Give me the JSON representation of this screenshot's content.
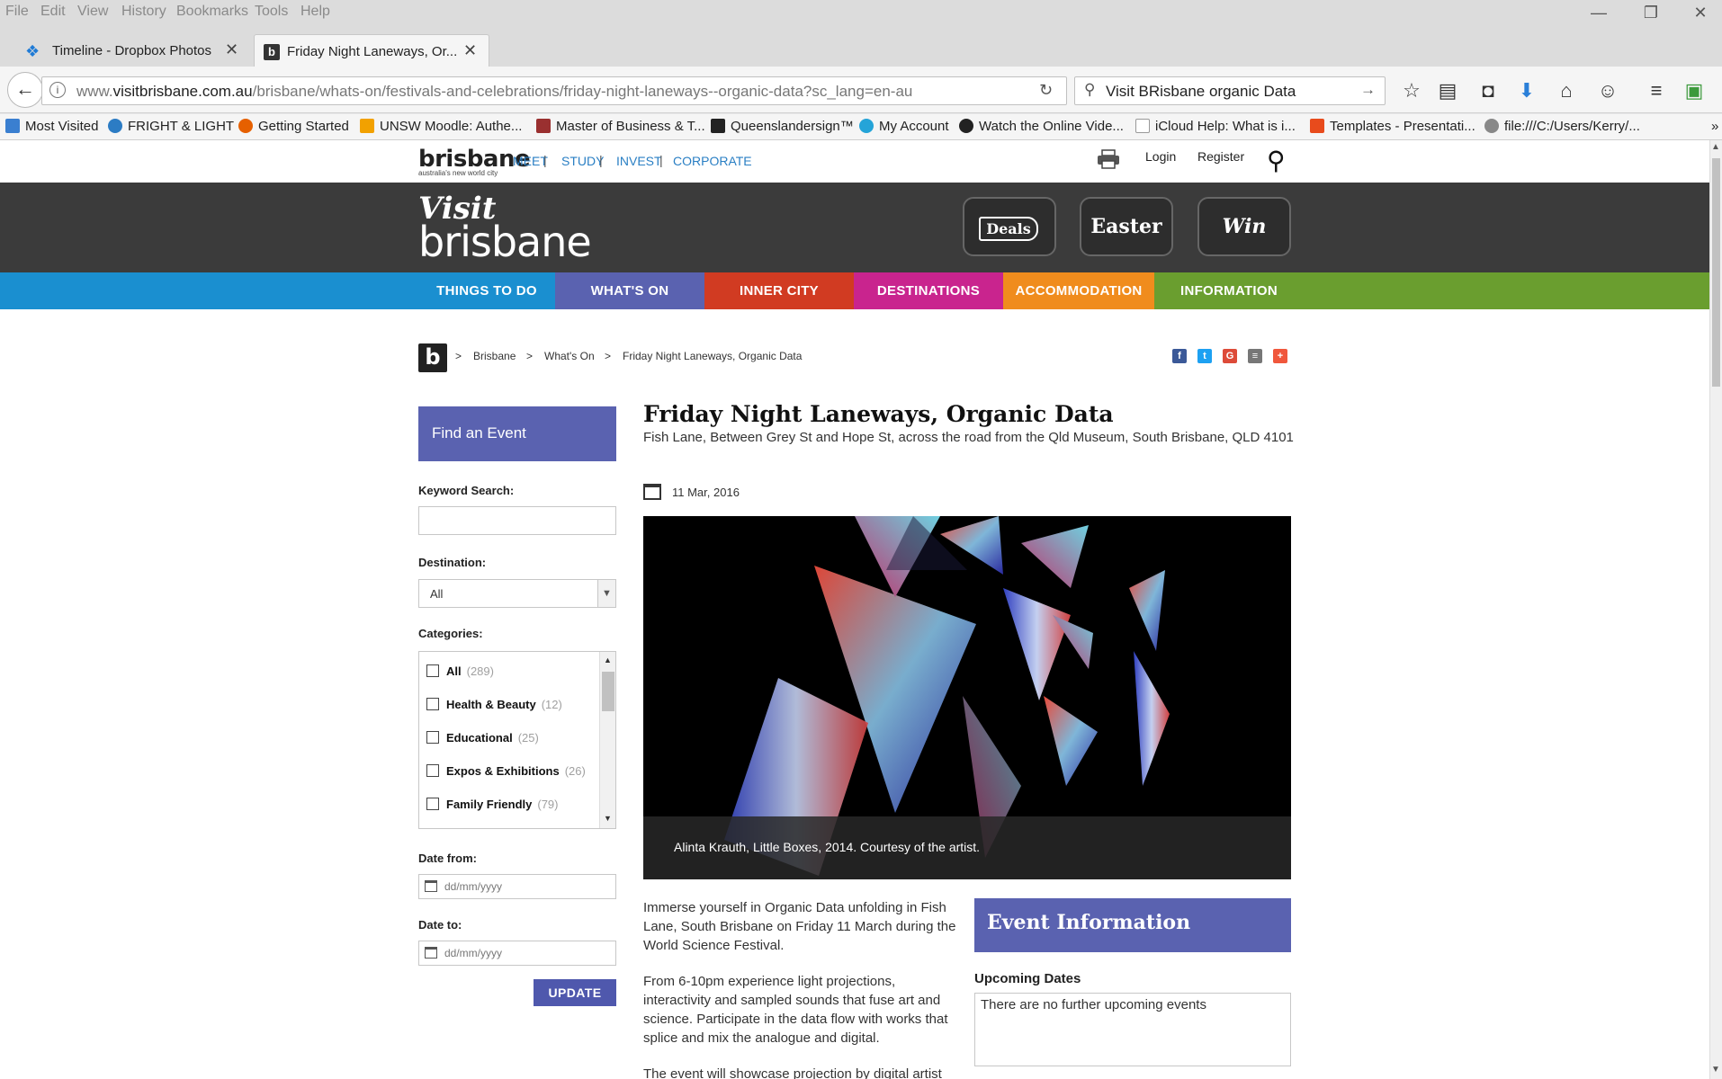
{
  "browser": {
    "menu": [
      "File",
      "Edit",
      "View",
      "History",
      "Bookmarks",
      "Tools",
      "Help"
    ],
    "window_controls": [
      "—",
      "❐",
      "✕"
    ],
    "tabs": [
      {
        "title": "Timeline - Dropbox Photos",
        "icon": "dropbox-icon",
        "active": false
      },
      {
        "title": "Friday Night Laneways, Or...",
        "icon": "b-favicon",
        "active": true
      }
    ],
    "new_tab": "+",
    "url_prefix": "www.",
    "url_domain": "visitbrisbane.com.au",
    "url_path": "/brisbane/whats-on/festivals-and-celebrations/friday-night-laneways--organic-data?sc_lang=en-au",
    "search_value": "Visit BRisbane organic Data",
    "bookmarks": [
      {
        "label": "Most Visited",
        "color": "#3a7fd0"
      },
      {
        "label": "FRIGHT & LIGHT",
        "color": "#2c7cc4"
      },
      {
        "label": "Getting Started",
        "color": "#e66000"
      },
      {
        "label": "UNSW Moodle: Authe...",
        "color": "#f2a100"
      },
      {
        "label": "Master of Business & T...",
        "color": "#9a3030"
      },
      {
        "label": "Queenslandersign™",
        "color": "#222222"
      },
      {
        "label": "My Account",
        "color": "#25a4d8"
      },
      {
        "label": "Watch the Online Vide...",
        "color": "#222222"
      },
      {
        "label": "iCloud Help: What is i...",
        "color": "#999999"
      },
      {
        "label": "Templates - Presentati...",
        "color": "#e84b1c"
      },
      {
        "label": "file:///C:/Users/Kerry/...",
        "color": "#888888"
      }
    ],
    "bookmarks_overflow": "»"
  },
  "site": {
    "brand": "brisbane",
    "brand_tag": "australia's new world city",
    "top_links": [
      "MEET",
      "STUDY",
      "INVEST",
      "CORPORATE"
    ],
    "account_links": [
      "Login",
      "Register"
    ],
    "logo_line1": "Visit",
    "logo_line2": "brisbane",
    "header_buttons": [
      "Deals",
      "Easter",
      "Win"
    ],
    "nav": [
      {
        "label": "THINGS TO DO",
        "color": "#1a8fd0"
      },
      {
        "label": "WHAT'S ON",
        "color": "#5a62b0"
      },
      {
        "label": "INNER CITY",
        "color": "#d13b22"
      },
      {
        "label": "DESTINATIONS",
        "color": "#c9248e"
      },
      {
        "label": "ACCOMMODATION",
        "color": "#f08c1d"
      },
      {
        "label": "INFORMATION",
        "color": "#6a9e2f"
      }
    ],
    "nav_tail_color": "#6a9e2f",
    "nav_lead_color": "#1a8fd0"
  },
  "breadcrumb": {
    "logo": "b",
    "items": [
      "Brisbane",
      "What's On",
      "Friday Night Laneways, Organic Data"
    ],
    "separator": ">"
  },
  "share": [
    {
      "name": "facebook",
      "glyph": "f",
      "color": "#3b5998"
    },
    {
      "name": "twitter",
      "glyph": "t",
      "color": "#1da1f2"
    },
    {
      "name": "google",
      "glyph": "G",
      "color": "#dd4b39"
    },
    {
      "name": "email",
      "glyph": "≡",
      "color": "#777777"
    },
    {
      "name": "more",
      "glyph": "+",
      "color": "#f0573c"
    }
  ],
  "sidebar": {
    "heading": "Find an Event",
    "keyword_label": "Keyword Search:",
    "destination_label": "Destination:",
    "destination_value": "All",
    "categories_label": "Categories:",
    "categories": [
      {
        "name": "All",
        "count": "(289)"
      },
      {
        "name": "Health & Beauty",
        "count": "(12)"
      },
      {
        "name": "Educational",
        "count": "(25)"
      },
      {
        "name": "Expos & Exhibitions",
        "count": "(26)"
      },
      {
        "name": "Family Friendly",
        "count": "(79)"
      }
    ],
    "date_from_label": "Date from:",
    "date_to_label": "Date to:",
    "date_placeholder": "dd/mm/yyyy",
    "update_label": "UPDATE"
  },
  "event": {
    "title": "Friday Night Laneways, Organic Data",
    "address": "Fish Lane, Between Grey St and Hope St, across the road from the Qld Museum, South Brisbane, QLD 4101",
    "date": "11 Mar, 2016",
    "image_caption": "Alinta Krauth, Little Boxes, 2014. Courtesy of the artist.",
    "paragraphs": [
      "Immerse yourself in Organic Data unfolding in Fish Lane, South Brisbane on Friday 11 March during the World Science Festival.",
      "From 6-10pm experience light projections, interactivity and sampled sounds that fuse art and science. Participate in the data flow with works that splice and mix the analogue and digital.",
      "The event will showcase projection by digital artist"
    ],
    "info_heading": "Event Information",
    "upcoming_label": "Upcoming Dates",
    "upcoming_text": "There are no further upcoming events"
  }
}
